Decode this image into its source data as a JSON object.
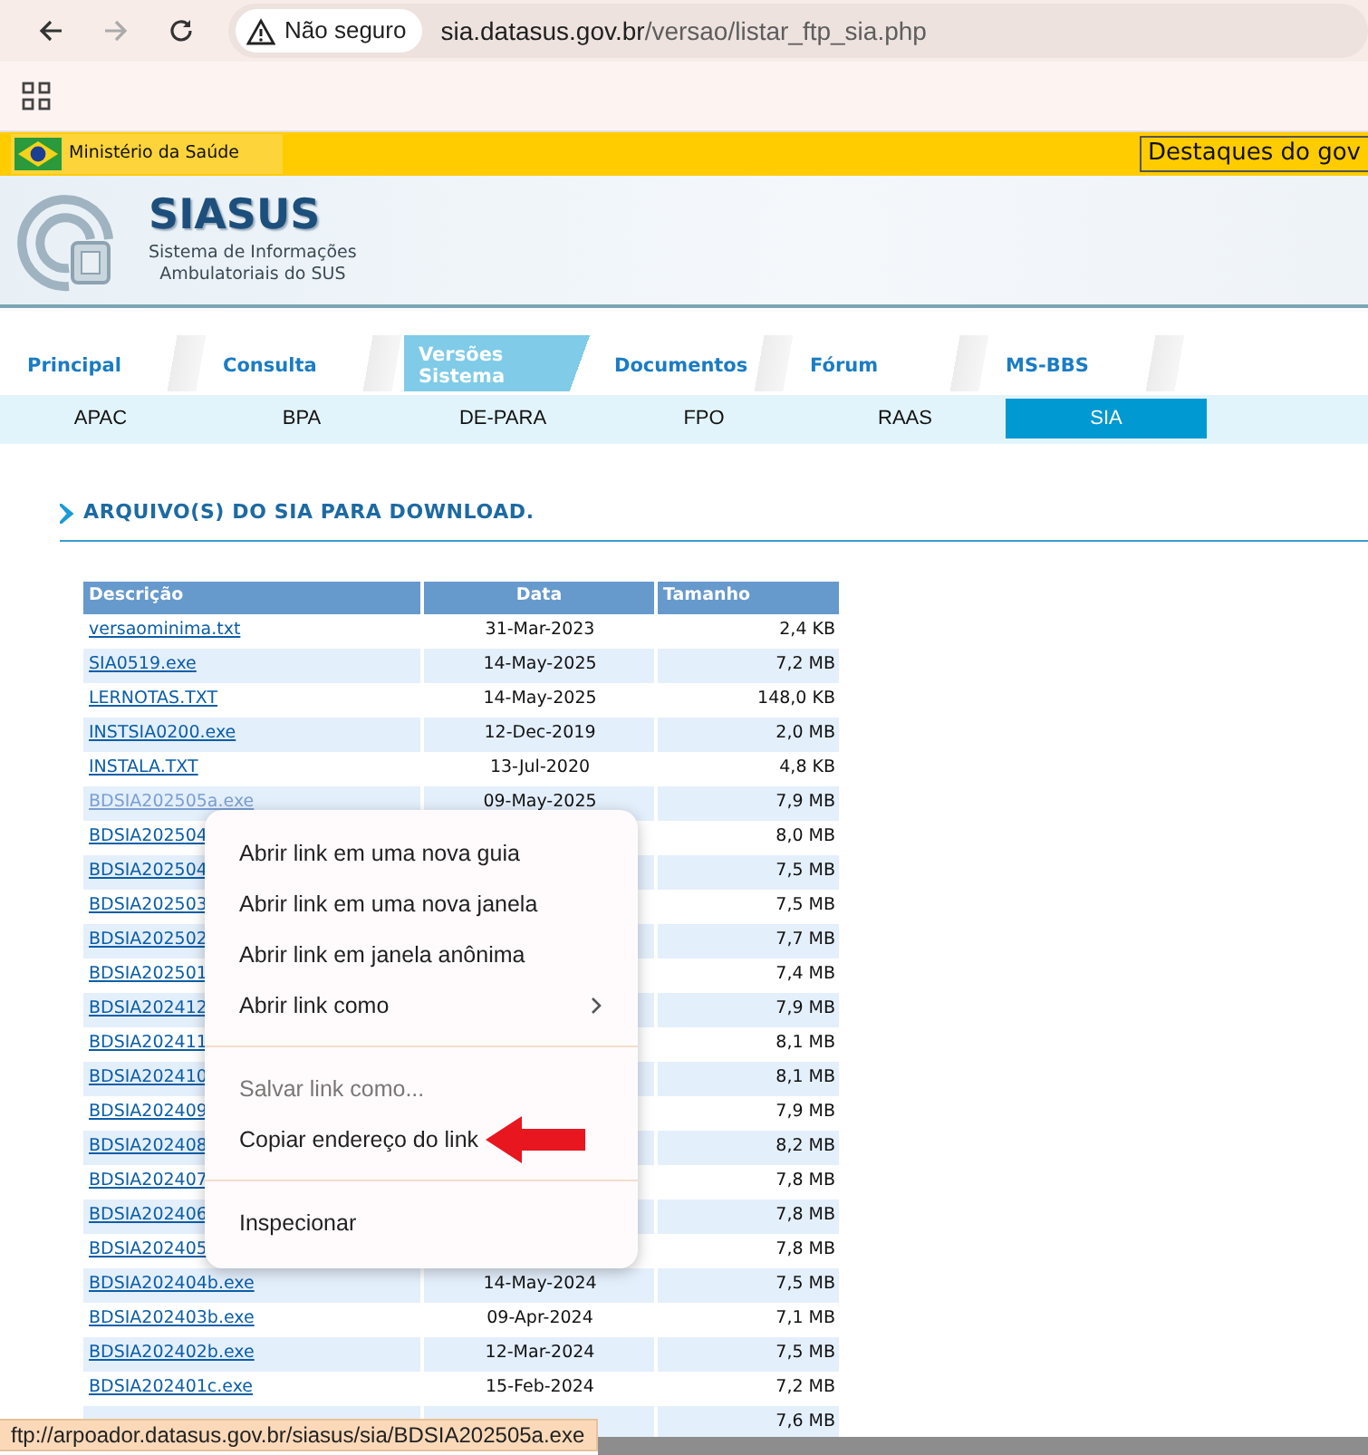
{
  "browser": {
    "security_label": "Não seguro",
    "url_host": "sia.datasus.gov.br",
    "url_path": "/versao/listar_ftp_sia.php"
  },
  "gov_bar": {
    "label": "Ministério da Saúde",
    "highlights": "Destaques do gov"
  },
  "header": {
    "title": "SIASUS",
    "subtitle": [
      "Sistema de Informações",
      "Ambulatoriais do SUS"
    ]
  },
  "tabs": [
    {
      "label": "Principal",
      "selected": false
    },
    {
      "label": "Consulta",
      "selected": false
    },
    {
      "label": "Versões Sistema",
      "selected": true
    },
    {
      "label": "Documentos",
      "selected": false
    },
    {
      "label": "Fórum",
      "selected": false
    },
    {
      "label": "MS-BBS",
      "selected": false
    }
  ],
  "subnav": [
    {
      "label": "APAC",
      "selected": false
    },
    {
      "label": "BPA",
      "selected": false
    },
    {
      "label": "DE-PARA",
      "selected": false
    },
    {
      "label": "FPO",
      "selected": false
    },
    {
      "label": "RAAS",
      "selected": false
    },
    {
      "label": "SIA",
      "selected": true
    }
  ],
  "section_title": "ARQUIVO(S) DO SIA PARA DOWNLOAD.",
  "table": {
    "columns": [
      "Descrição",
      "Data",
      "Tamanho"
    ],
    "rows": [
      {
        "description": "versaominima.txt",
        "date": "31-Mar-2023",
        "size": "2,4 KB"
      },
      {
        "description": "SIA0519.exe",
        "date": "14-May-2025",
        "size": "7,2 MB"
      },
      {
        "description": "LERNOTAS.TXT",
        "date": "14-May-2025",
        "size": "148,0 KB"
      },
      {
        "description": "INSTSIA0200.exe",
        "date": "12-Dec-2019",
        "size": "2,0 MB"
      },
      {
        "description": "INSTALA.TXT",
        "date": "13-Jul-2020",
        "size": "4,8 KB"
      },
      {
        "description": "BDSIA202505a.exe",
        "date": "09-May-2025",
        "size": "7,9 MB",
        "highlighted": true
      },
      {
        "description": "BDSIA202504",
        "size": "8,0 MB"
      },
      {
        "description": "BDSIA202504",
        "size": "7,5 MB"
      },
      {
        "description": "BDSIA202503",
        "size": "7,5 MB"
      },
      {
        "description": "BDSIA202502",
        "size": "7,7 MB"
      },
      {
        "description": "BDSIA202501",
        "size": "7,4 MB"
      },
      {
        "description": "BDSIA202412",
        "size": "7,9 MB"
      },
      {
        "description": "BDSIA202411",
        "size": "8,1 MB"
      },
      {
        "description": "BDSIA202410",
        "size": "8,1 MB"
      },
      {
        "description": "BDSIA202409",
        "size": "7,9 MB"
      },
      {
        "description": "BDSIA202408",
        "size": "8,2 MB"
      },
      {
        "description": "BDSIA202407",
        "size": "7,8 MB"
      },
      {
        "description": "BDSIA202406",
        "size": "7,8 MB"
      },
      {
        "description": "BDSIA202405",
        "size": "7,8 MB"
      },
      {
        "description": "BDSIA202404b.exe",
        "date": "14-May-2024",
        "size": "7,5 MB"
      },
      {
        "description": "BDSIA202403b.exe",
        "date": "09-Apr-2024",
        "size": "7,1 MB"
      },
      {
        "description": "BDSIA202402b.exe",
        "date": "12-Mar-2024",
        "size": "7,5 MB"
      },
      {
        "description": "BDSIA202401c.exe",
        "date": "15-Feb-2024",
        "size": "7,2 MB"
      },
      {
        "size": "7,6 MB"
      }
    ]
  },
  "context_menu": [
    {
      "kind": "item",
      "label": "Abrir link em uma nova guia",
      "disabled": false,
      "submenu": false
    },
    {
      "kind": "item",
      "label": "Abrir link em uma nova janela",
      "disabled": false,
      "submenu": false
    },
    {
      "kind": "item",
      "label": "Abrir link em janela anônima",
      "disabled": false,
      "submenu": false
    },
    {
      "kind": "item",
      "label": "Abrir link como",
      "disabled": false,
      "submenu": true
    },
    {
      "kind": "separator"
    },
    {
      "kind": "item",
      "label": "Salvar link como...",
      "disabled": true,
      "submenu": false
    },
    {
      "kind": "item",
      "label": "Copiar endereço do link",
      "disabled": false,
      "submenu": false,
      "annotated": true
    },
    {
      "kind": "separator"
    },
    {
      "kind": "item",
      "label": "Inspecionar",
      "disabled": false,
      "submenu": false
    }
  ],
  "status_bar": "ftp://arpoador.datasus.gov.br/siasus/sia/BDSIA202505a.exe"
}
